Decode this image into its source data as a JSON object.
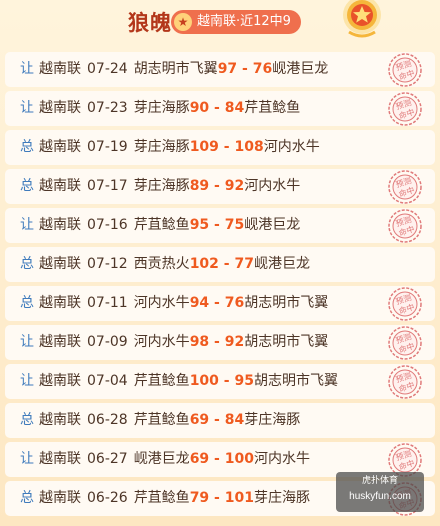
{
  "header": {
    "title": "狼魄",
    "badge": "越南联·近12中9",
    "badge_icon": "star-icon",
    "medal_icon": "gold-medal-icon"
  },
  "stamp_text": "预测命中",
  "records": [
    {
      "type": "让",
      "league": "越南联",
      "date": "07-24",
      "home": "胡志明市飞翼",
      "score": "97 - 76",
      "away": "岘港巨龙",
      "hit": true
    },
    {
      "type": "让",
      "league": "越南联",
      "date": "07-23",
      "home": "芽庄海豚",
      "score": "90 - 84",
      "away": "芹苴鲶鱼",
      "hit": true
    },
    {
      "type": "总",
      "league": "越南联",
      "date": "07-19",
      "home": "芽庄海豚",
      "score": "109 - 108",
      "away": "河内水牛",
      "hit": false
    },
    {
      "type": "总",
      "league": "越南联",
      "date": "07-17",
      "home": "芽庄海豚",
      "score": "89 - 92",
      "away": "河内水牛",
      "hit": true
    },
    {
      "type": "让",
      "league": "越南联",
      "date": "07-16",
      "home": "芹苴鲶鱼",
      "score": "95 - 75",
      "away": "岘港巨龙",
      "hit": true
    },
    {
      "type": "总",
      "league": "越南联",
      "date": "07-12",
      "home": "西贡热火",
      "score": "102 - 77",
      "away": "岘港巨龙",
      "hit": false
    },
    {
      "type": "总",
      "league": "越南联",
      "date": "07-11",
      "home": "河内水牛",
      "score": "94 - 76",
      "away": "胡志明市飞翼",
      "hit": true
    },
    {
      "type": "让",
      "league": "越南联",
      "date": "07-09",
      "home": "河内水牛",
      "score": "98 - 92",
      "away": "胡志明市飞翼",
      "hit": true
    },
    {
      "type": "让",
      "league": "越南联",
      "date": "07-04",
      "home": "芹苴鲶鱼",
      "score": "100 - 95",
      "away": "胡志明市飞翼",
      "hit": true
    },
    {
      "type": "总",
      "league": "越南联",
      "date": "06-28",
      "home": "芹苴鲶鱼",
      "score": "69 - 84",
      "away": "芽庄海豚",
      "hit": false
    },
    {
      "type": "让",
      "league": "越南联",
      "date": "06-27",
      "home": "岘港巨龙",
      "score": "69 - 100",
      "away": "河内水牛",
      "hit": true
    },
    {
      "type": "总",
      "league": "越南联",
      "date": "06-26",
      "home": "芹苴鲶鱼",
      "score": "79 - 101",
      "away": "芽庄海豚",
      "hit": true
    }
  ],
  "watermark": {
    "line1": "虎扑体育",
    "line2": "huskyfun.com"
  },
  "colors": {
    "accent": "#ef5a1f",
    "title": "#b3371a",
    "type_label": "#3f7bbc",
    "stamp": "#e07a7a",
    "row_bg": "#fffaf3"
  }
}
